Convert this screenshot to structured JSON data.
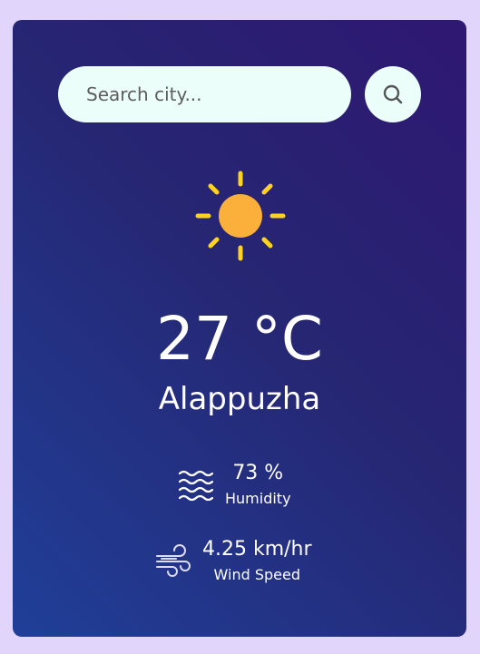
{
  "search": {
    "placeholder": "Search city...",
    "value": ""
  },
  "weather": {
    "icon": "sun-icon",
    "temperature": "27 °C",
    "city": "Alappuzha"
  },
  "details": {
    "humidity": {
      "icon": "humidity-icon",
      "value": "73 %",
      "label": "Humidity"
    },
    "wind": {
      "icon": "wind-icon",
      "value": "4.25 km/hr",
      "label": "Wind Speed"
    }
  },
  "colors": {
    "background": "#e2d5fb",
    "card_gradient_start": "#2f1772",
    "card_gradient_end": "#203f98",
    "input_background": "#ebfefa",
    "sun": "#fbb03b",
    "sun_rays": "#ffd21e"
  }
}
